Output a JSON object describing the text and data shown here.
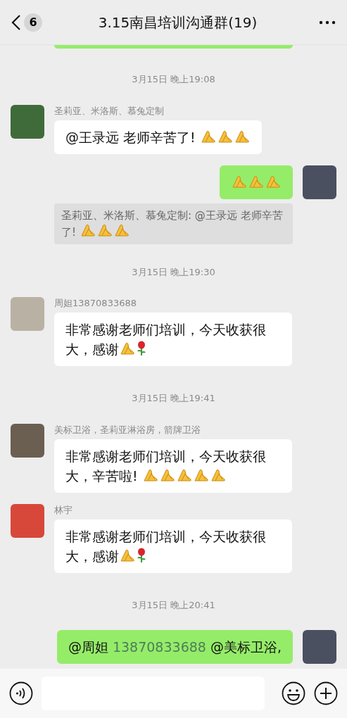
{
  "header": {
    "back_badge": "6",
    "title": "3.15南昌培训沟通群(19)"
  },
  "messages": [
    {
      "kind": "cutoff"
    },
    {
      "kind": "time",
      "text": "3月15日 晚上19:08"
    },
    {
      "kind": "received",
      "sender": "圣莉亚、米洛斯、慕兔定制",
      "color": "#3f6b3a",
      "parts": [
        {
          "kind": "text",
          "text": "@王录远  老师辛苦了! "
        },
        {
          "kind": "pray"
        },
        {
          "kind": "pray"
        },
        {
          "kind": "pray"
        }
      ]
    },
    {
      "kind": "sent",
      "color": "#4a5060",
      "parts": [
        {
          "kind": "pray"
        },
        {
          "kind": "pray"
        },
        {
          "kind": "pray"
        }
      ]
    },
    {
      "kind": "quote",
      "parts": [
        {
          "kind": "text",
          "text": "圣莉亚、米洛斯、慕兔定制: @王录远 老师辛苦了! "
        },
        {
          "kind": "pray"
        },
        {
          "kind": "pray"
        },
        {
          "kind": "pray"
        }
      ]
    },
    {
      "kind": "time",
      "text": "3月15日 晚上19:30"
    },
    {
      "kind": "received",
      "sender": "周妲13870833688",
      "color": "#b9b2a4",
      "parts": [
        {
          "kind": "text",
          "text": "非常感谢老师们培训，今天收获很大，感谢"
        },
        {
          "kind": "pray"
        },
        {
          "kind": "rose"
        }
      ]
    },
    {
      "kind": "time",
      "text": "3月15日 晚上19:41"
    },
    {
      "kind": "received",
      "sender": "美标卫浴，圣莉亚淋浴房，箭牌卫浴",
      "color": "#6b5f52",
      "parts": [
        {
          "kind": "text",
          "text": "非常感谢老师们培训，今天收获很大，辛苦啦! "
        },
        {
          "kind": "pray"
        },
        {
          "kind": "pray"
        },
        {
          "kind": "pray"
        },
        {
          "kind": "pray"
        },
        {
          "kind": "pray"
        }
      ]
    },
    {
      "kind": "received",
      "sender": "林宇",
      "color": "#d8483a",
      "parts": [
        {
          "kind": "text",
          "text": "非常感谢老师们培训，今天收获很大，感谢"
        },
        {
          "kind": "pray"
        },
        {
          "kind": "rose"
        }
      ]
    },
    {
      "kind": "time",
      "text": "3月15日 晚上20:41"
    },
    {
      "kind": "sent",
      "color": "#4a5060",
      "parts": [
        {
          "kind": "text",
          "text": "@周妲 "
        },
        {
          "kind": "link",
          "text": "13870833688"
        },
        {
          "kind": "text",
          "text": " @美标卫浴,"
        }
      ]
    }
  ]
}
